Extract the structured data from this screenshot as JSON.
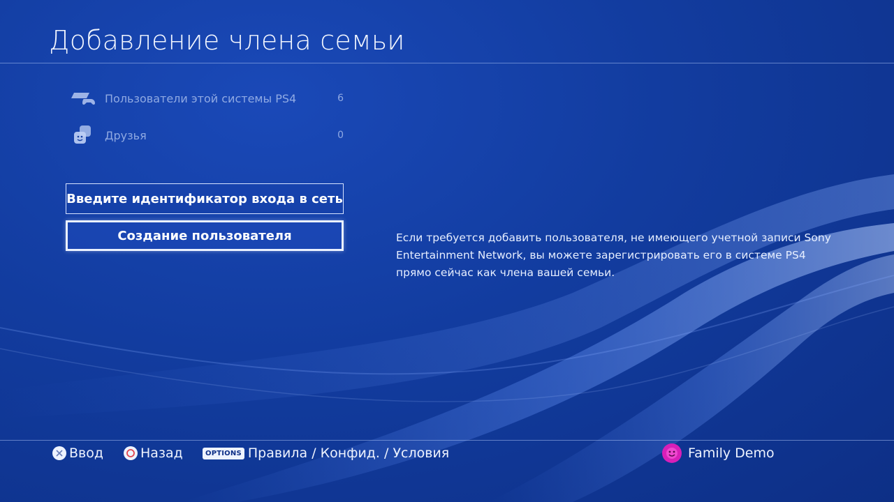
{
  "header": {
    "title": "Добавление члена семьи"
  },
  "sources": [
    {
      "icon": "ps4-console-icon",
      "label": "Пользователи этой системы PS4",
      "count": "6"
    },
    {
      "icon": "friends-icon",
      "label": "Друзья",
      "count": "0"
    }
  ],
  "actions": {
    "enter_id_label": "Введите идентификатор входа в сеть",
    "create_user_label": "Создание пользователя"
  },
  "description": "Если требуется добавить пользователя, не имеющего учетной записи Sony Entertainment Network, вы можете зарегистрировать его в системе PS4 прямо сейчас как члена вашей семьи.",
  "footer": {
    "enter_label": "Ввод",
    "back_label": "Назад",
    "options_badge": "OPTIONS",
    "options_label": "Правила / Конфид. / Условия",
    "user_name": "Family Demo"
  },
  "colors": {
    "background": "#123c9f",
    "avatar": "#d81fb8",
    "text": "#ffffff"
  }
}
